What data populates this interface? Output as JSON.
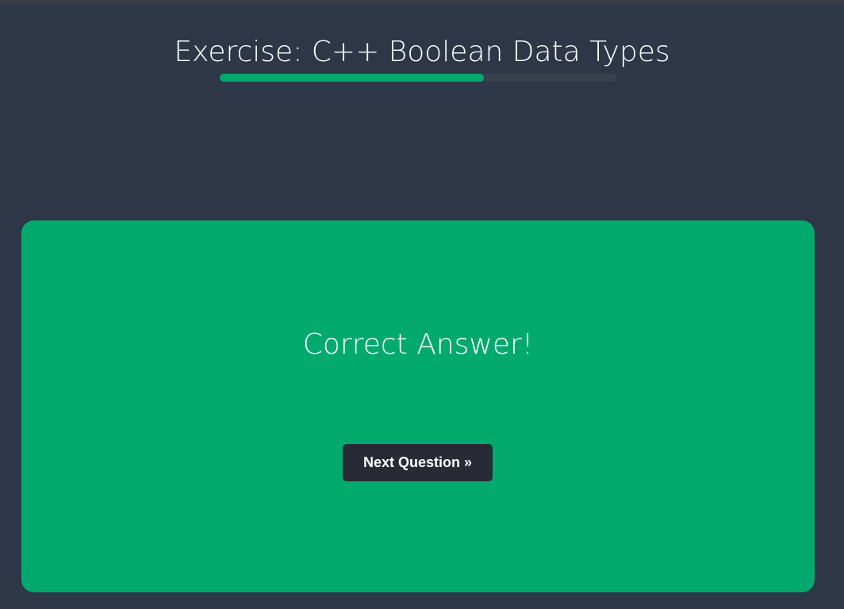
{
  "header": {
    "title": "Exercise: C++ Boolean Data Types"
  },
  "progress": {
    "fraction": 0.666
  },
  "result": {
    "message": "Correct Answer!",
    "next_label": "Next Question »"
  },
  "colors": {
    "background": "#2d3748",
    "accent": "#04aa6d",
    "button": "#282a35"
  }
}
